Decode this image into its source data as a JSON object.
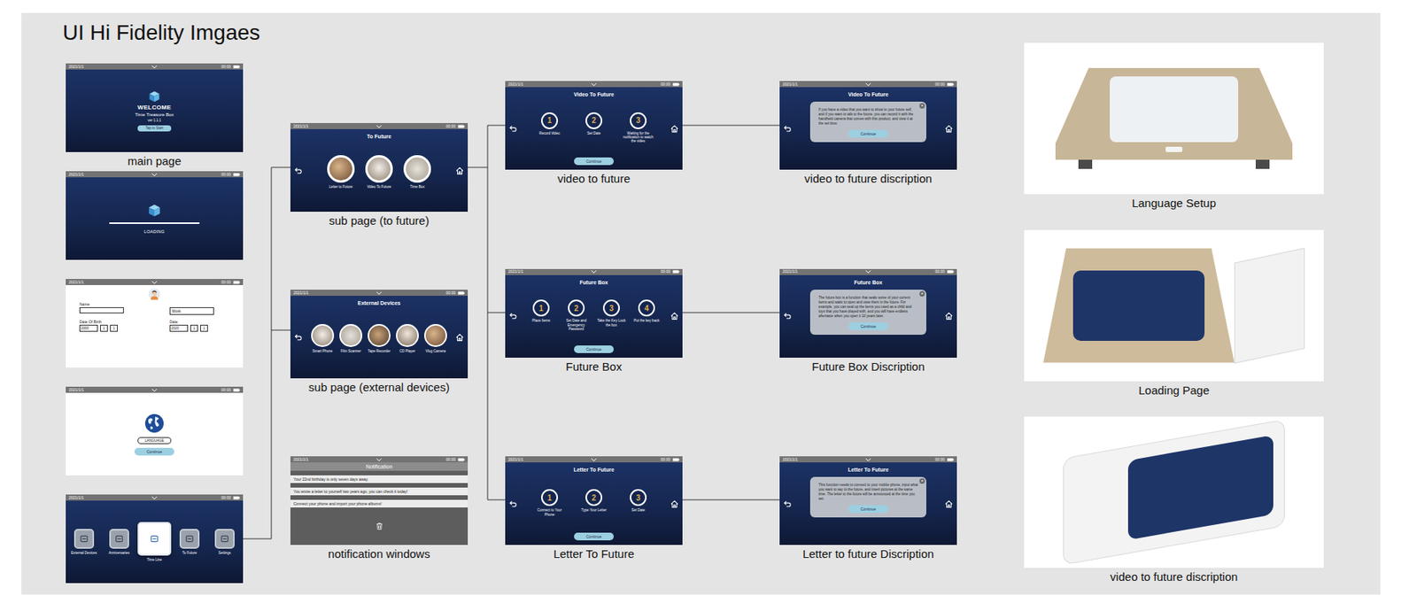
{
  "title": "UI Hi Fidelity Imgaes",
  "status_bar": {
    "date": "2021/1/1",
    "time": "00:00"
  },
  "main_page": {
    "label": "main page",
    "heading": "WELCOME",
    "app_name": "Time Treasure Box",
    "version": "ver 1.1.1",
    "button": "Tap to Start"
  },
  "loading_page": {
    "text": "LOADING",
    "level": 1
  },
  "profile_page": {
    "name_label": "Name",
    "work_value": "Work",
    "birth_label": "Date Of Birth",
    "birth_date": [
      "2000",
      "1",
      "1"
    ],
    "date_label": "Date",
    "date": [
      "2020",
      "1",
      "1"
    ]
  },
  "language_page": {
    "placeholder": "LANGUAGE",
    "button": "Continue"
  },
  "home_page": {
    "apps": [
      {
        "label": "External Devices",
        "selected": false
      },
      {
        "label": "Anniversaries",
        "selected": false
      },
      {
        "label": "Time Line",
        "selected": true
      },
      {
        "label": "To Future",
        "selected": false
      },
      {
        "label": "Settings",
        "selected": false
      }
    ]
  },
  "sub_pages": [
    {
      "label": "sub page (to future)",
      "title": "To Future",
      "items": [
        "Letter to Future",
        "Video To Future",
        "Time Box"
      ]
    },
    {
      "label": "sub page (external devices)",
      "title": "External Devices",
      "items": [
        "Smart Phone",
        "Film Scanner",
        "Tape Recorder",
        "CD Player",
        "Vlog Camera"
      ]
    }
  ],
  "notification": {
    "label": "notification windows",
    "title": "Notification",
    "messages": [
      "Your 22nd birthday is only seven days away.",
      "You wrote a letter to yourself two years ago, you can check it today!",
      "Connect your phone and import your phone albums!"
    ]
  },
  "step_pages": [
    {
      "label": "video to future",
      "title": "Video To Future",
      "button": "Continue",
      "steps": [
        {
          "number": "1",
          "text": "Record Video"
        },
        {
          "number": "2",
          "text": "Set Date"
        },
        {
          "number": "3",
          "text": "Waiting for the notification to watch the video"
        }
      ]
    },
    {
      "label": "Future Box",
      "title": "Future Box",
      "button": "Continue",
      "steps": [
        {
          "number": "1",
          "text": "Place Items"
        },
        {
          "number": "2",
          "text": "Set Date and Emergency Password"
        },
        {
          "number": "3",
          "text": "Take the Key Lock the box"
        },
        {
          "number": "4",
          "text": "Put the key back"
        }
      ]
    },
    {
      "label": "Letter To Future",
      "title": "Letter To Future",
      "button": "Continue",
      "steps": [
        {
          "number": "1",
          "text": "Connect to Your Phone"
        },
        {
          "number": "2",
          "text": "Type Your Letter"
        },
        {
          "number": "3",
          "text": "Set Date"
        }
      ]
    }
  ],
  "descriptions": [
    {
      "label": "video to future discription",
      "title": "Video To Future",
      "close": "×",
      "button": "Continue",
      "text": "If you have a video that you want to show to your future self, and if you want to talk to the future, you can record it with the handheld camera that comes with this product, and view it at the set time."
    },
    {
      "label": "Future Box Discription",
      "title": "Future Box",
      "close": "×",
      "button": "Continue",
      "text": "The future box is a function that seals some of your current items and waits to open and view them in the future. For example, you can seal up the items you used as a child and toys that you have played with, and you will have endless aftertaste when you open it 10 years later."
    },
    {
      "label": "Letter to future Discription",
      "title": "Letter To Future",
      "close": "×",
      "button": "Continue",
      "text": "This function needs to connect to your mobile phone, input what you want to say to the future, and insert pictures at the same time. The letter to the future will be announced at the time you set."
    }
  ],
  "photos": [
    {
      "label": "Language Setup",
      "kind": "front"
    },
    {
      "label": "Loading Page",
      "kind": "angled"
    },
    {
      "label": "video to future discription",
      "kind": "side"
    }
  ]
}
